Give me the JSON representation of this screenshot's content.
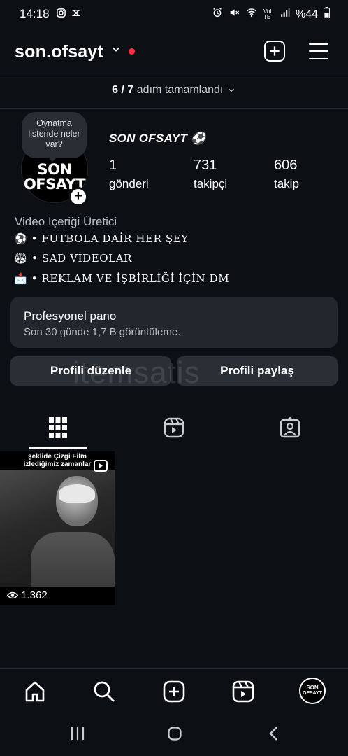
{
  "status_bar": {
    "time": "14:18",
    "battery": "%44",
    "network": "VoLTE"
  },
  "header": {
    "username": "son.ofsayt"
  },
  "setup": {
    "text_strong": "6 / 7",
    "text_rest": "adım tamamlandı"
  },
  "note_bubble": {
    "text": "Oynatma listende neler var?"
  },
  "avatar": {
    "line1": "SON",
    "line2": "OFSAYT",
    "mini_line1": "SON",
    "mini_line2": "OFSAYT"
  },
  "profile": {
    "display_name": "SON OFSAYT ⚽",
    "stats": [
      {
        "value": "1",
        "label": "gönderi"
      },
      {
        "value": "731",
        "label": "takipçi"
      },
      {
        "value": "606",
        "label": "takip"
      }
    ],
    "category": "Video İçeriği Üretici",
    "bio": [
      {
        "emoji": "⚽",
        "text": "• FUTBOLA DAİR HER ŞEY"
      },
      {
        "emoji": "🏟",
        "text": "• SAD VİDEOLAR"
      },
      {
        "emoji": "📩",
        "text": "• REKLAM VE İŞBİRLİĞİ İÇİN DM"
      }
    ]
  },
  "dashboard": {
    "title": "Profesyonel pano",
    "subtitle": "Son 30 günde 1,7 B görüntüleme."
  },
  "buttons": {
    "edit": "Profili düzenle",
    "share": "Profili paylaş"
  },
  "watermark": "itemsatis",
  "post": {
    "caption": "şeklide Çizgi Film\nizlediğimiz zamanlar",
    "views": "1.362"
  },
  "icons": {
    "tabs": [
      "grid-icon",
      "reels-icon",
      "tagged-icon"
    ],
    "bottom_nav": [
      "home-icon",
      "search-icon",
      "create-icon",
      "reels-icon",
      "profile-avatar"
    ]
  }
}
